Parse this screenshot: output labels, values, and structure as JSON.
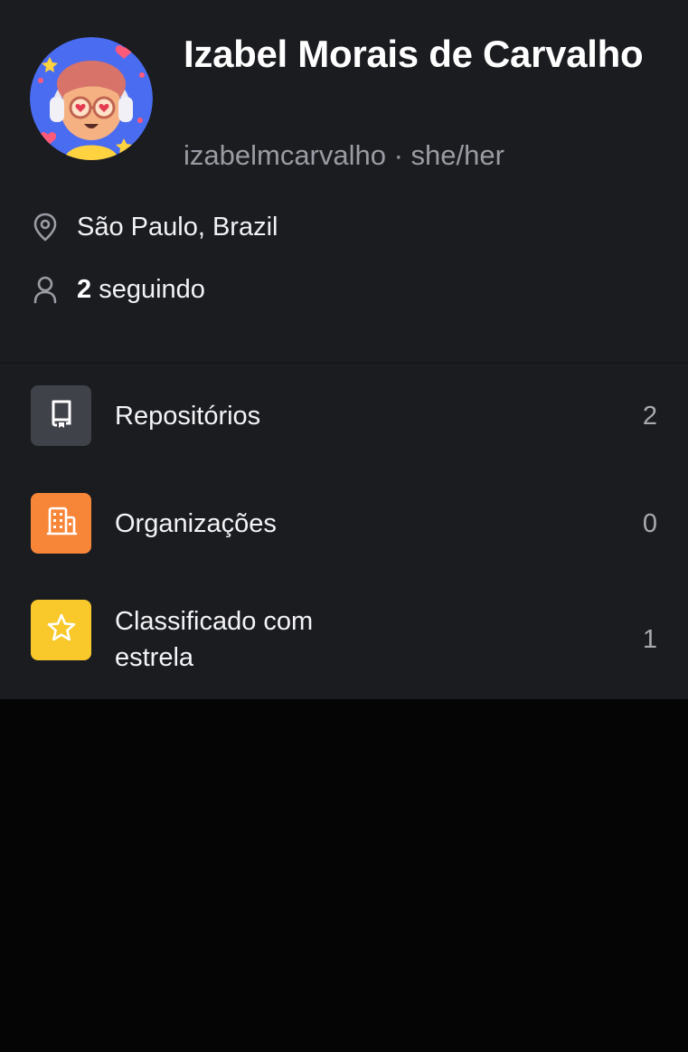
{
  "profile": {
    "name": "Izabel Morais de Carvalho",
    "handle_line": "izabelmcarvalho · she/her",
    "location": "São Paulo, Brazil",
    "following_count": "2",
    "following_label": " seguindo",
    "avatar_icon": "avatar-illustration"
  },
  "menu": {
    "items": [
      {
        "label": "Repositórios",
        "count": "2",
        "icon": "repo-icon",
        "color": "#40424a"
      },
      {
        "label": "Organizações",
        "count": "0",
        "icon": "organization-icon",
        "color": "#f78639"
      },
      {
        "label": "Classificado com estrela",
        "count": "1",
        "icon": "star-icon",
        "color": "#f9c92b"
      }
    ]
  },
  "colors": {
    "background": "#1b1c20",
    "page_background": "#050505",
    "secondary_text": "#9b9ca3"
  }
}
